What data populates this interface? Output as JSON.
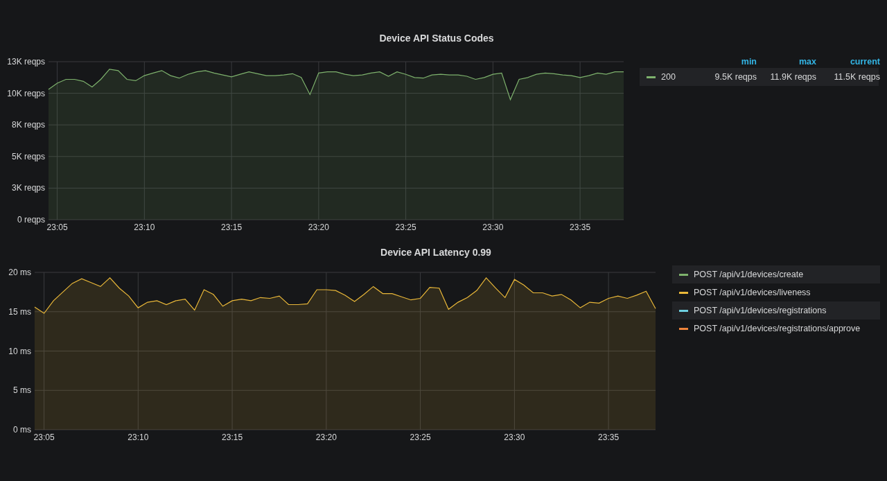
{
  "panels": [
    {
      "title": "Device API Status Codes",
      "chart_data": {
        "type": "area",
        "grid": true,
        "ylim": [
          0,
          12500
        ],
        "yticks": [
          {
            "value": 0,
            "label": "0 reqps"
          },
          {
            "value": 2500,
            "label": "3K reqps"
          },
          {
            "value": 5000,
            "label": "5K reqps"
          },
          {
            "value": 7500,
            "label": "8K reqps"
          },
          {
            "value": 10000,
            "label": "10K reqps"
          },
          {
            "value": 12500,
            "label": "13K reqps"
          }
        ],
        "categories": [
          null,
          "23:05",
          null,
          null,
          null,
          null,
          null,
          null,
          null,
          null,
          null,
          "23:10",
          null,
          null,
          null,
          null,
          null,
          null,
          null,
          null,
          null,
          "23:15",
          null,
          null,
          null,
          null,
          null,
          null,
          null,
          null,
          null,
          "23:20",
          null,
          null,
          null,
          null,
          null,
          null,
          null,
          null,
          null,
          "23:25",
          null,
          null,
          null,
          null,
          null,
          null,
          null,
          null,
          null,
          "23:30",
          null,
          null,
          null,
          null,
          null,
          null,
          null,
          null,
          null,
          "23:35",
          null,
          null,
          null,
          null,
          null
        ],
        "series": [
          {
            "color": "#7eb26d",
            "values": [
              10300,
              10800,
              11100,
              11100,
              10950,
              10500,
              11100,
              11900,
              11800,
              11100,
              11000,
              11400,
              11600,
              11800,
              11400,
              11200,
              11500,
              11700,
              11800,
              11600,
              11450,
              11300,
              11500,
              11700,
              11550,
              11400,
              11400,
              11450,
              11550,
              11250,
              9900,
              11600,
              11700,
              11700,
              11500,
              11400,
              11450,
              11600,
              11700,
              11350,
              11700,
              11500,
              11250,
              11200,
              11450,
              11500,
              11450,
              11450,
              11350,
              11100,
              11250,
              11500,
              11600,
              9500,
              11100,
              11250,
              11500,
              11600,
              11550,
              11450,
              11400,
              11250,
              11400,
              11600,
              11500,
              11700,
              11700
            ]
          }
        ]
      },
      "legend": {
        "columns": [
          "min",
          "max",
          "current"
        ],
        "items": [
          {
            "name": "200",
            "color": "#7eb26d",
            "min": "9.5K reqps",
            "max": "11.9K reqps",
            "current": "11.5K reqps"
          }
        ]
      }
    },
    {
      "title": "Device API Latency 0.99",
      "chart_data": {
        "type": "area",
        "grid": true,
        "ylim": [
          0,
          20
        ],
        "yticks": [
          {
            "value": 0,
            "label": "0 ms"
          },
          {
            "value": 5,
            "label": "5 ms"
          },
          {
            "value": 10,
            "label": "10 ms"
          },
          {
            "value": 15,
            "label": "15 ms"
          },
          {
            "value": 20,
            "label": "20 ms"
          }
        ],
        "categories": [
          null,
          "23:05",
          null,
          null,
          null,
          null,
          null,
          null,
          null,
          null,
          null,
          "23:10",
          null,
          null,
          null,
          null,
          null,
          null,
          null,
          null,
          null,
          "23:15",
          null,
          null,
          null,
          null,
          null,
          null,
          null,
          null,
          null,
          "23:20",
          null,
          null,
          null,
          null,
          null,
          null,
          null,
          null,
          null,
          "23:25",
          null,
          null,
          null,
          null,
          null,
          null,
          null,
          null,
          null,
          "23:30",
          null,
          null,
          null,
          null,
          null,
          null,
          null,
          null,
          null,
          "23:35",
          null,
          null,
          null,
          null,
          null
        ],
        "series": [
          {
            "color": "#eab839",
            "values": [
              15.6,
              14.8,
              16.4,
              17.5,
              18.6,
              19.2,
              18.7,
              18.2,
              19.3,
              18.0,
              17.0,
              15.5,
              16.2,
              16.4,
              15.9,
              16.4,
              16.6,
              15.2,
              17.8,
              17.2,
              15.7,
              16.4,
              16.6,
              16.4,
              16.8,
              16.7,
              17.0,
              15.9,
              15.9,
              16.0,
              17.8,
              17.8,
              17.7,
              17.1,
              16.3,
              17.2,
              18.2,
              17.3,
              17.3,
              16.9,
              16.5,
              16.7,
              18.1,
              18.0,
              15.3,
              16.2,
              16.8,
              17.7,
              19.3,
              18.0,
              16.8,
              19.1,
              18.4,
              17.4,
              17.4,
              17.0,
              17.2,
              16.5,
              15.5,
              16.2,
              16.1,
              16.7,
              17.0,
              16.7,
              17.1,
              17.6,
              15.4
            ]
          }
        ]
      },
      "legend": {
        "items": [
          {
            "name": "POST /api/v1/devices/create",
            "color": "#7eb26d"
          },
          {
            "name": "POST /api/v1/devices/liveness",
            "color": "#eab839"
          },
          {
            "name": "POST /api/v1/devices/registrations",
            "color": "#6ed0e0"
          },
          {
            "name": "POST /api/v1/devices/registrations/approve",
            "color": "#ef843c"
          }
        ]
      }
    }
  ]
}
